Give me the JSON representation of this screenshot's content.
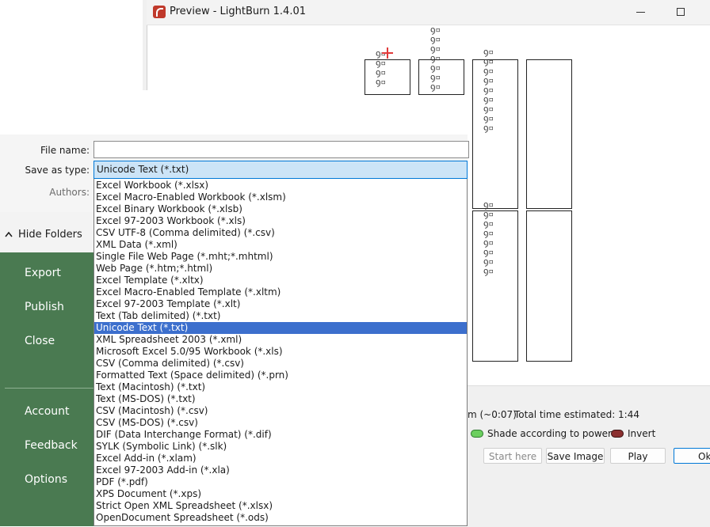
{
  "preview": {
    "title": "Preview - LightBurn 1.4.01",
    "time_text": "m (~0:07)",
    "total_time_label": "Total time estimated: 1:44",
    "shade_label": "Shade according to power",
    "invert_label": "Invert",
    "start_here_label": "Start here",
    "save_image_label": "Save Image",
    "play_label": "Play",
    "ok_label": "Ok",
    "jig_glyphs": "ꝯ▫"
  },
  "save_dialog": {
    "file_name_label": "File name:",
    "file_name_value": "",
    "save_as_type_label": "Save as type:",
    "save_as_type_value": "Unicode Text (*.txt)",
    "authors_label": "Authors:",
    "hide_folders_label": "Hide Folders",
    "file_types": [
      "Excel Workbook (*.xlsx)",
      "Excel Macro-Enabled Workbook (*.xlsm)",
      "Excel Binary Workbook (*.xlsb)",
      "Excel 97-2003 Workbook (*.xls)",
      "CSV UTF-8 (Comma delimited) (*.csv)",
      "XML Data (*.xml)",
      "Single File Web Page (*.mht;*.mhtml)",
      "Web Page (*.htm;*.html)",
      "Excel Template (*.xltx)",
      "Excel Macro-Enabled Template (*.xltm)",
      "Excel 97-2003 Template (*.xlt)",
      "Text (Tab delimited) (*.txt)",
      "Unicode Text (*.txt)",
      "XML Spreadsheet 2003 (*.xml)",
      "Microsoft Excel 5.0/95 Workbook (*.xls)",
      "CSV (Comma delimited) (*.csv)",
      "Formatted Text (Space delimited) (*.prn)",
      "Text (Macintosh) (*.txt)",
      "Text (MS-DOS) (*.txt)",
      "CSV (Macintosh) (*.csv)",
      "CSV (MS-DOS) (*.csv)",
      "DIF (Data Interchange Format) (*.dif)",
      "SYLK (Symbolic Link) (*.slk)",
      "Excel Add-in (*.xlam)",
      "Excel 97-2003 Add-in (*.xla)",
      "PDF (*.pdf)",
      "XPS Document (*.xps)",
      "Strict Open XML Spreadsheet (*.xlsx)",
      "OpenDocument Spreadsheet (*.ods)"
    ],
    "selected_type_index": 12
  },
  "backstage": {
    "nav": {
      "export": "Export",
      "publish": "Publish",
      "close": "Close",
      "account": "Account",
      "feedback": "Feedback",
      "options": "Options"
    },
    "sidebar_color": "#4a7a51"
  }
}
